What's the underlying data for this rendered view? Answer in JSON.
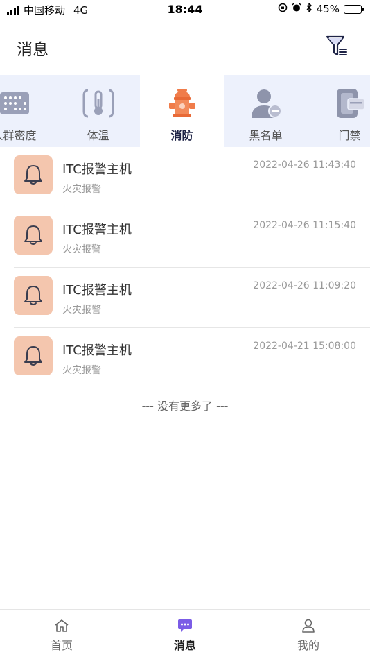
{
  "status_bar": {
    "carrier": "中国移动",
    "network": "4G",
    "time": "18:44",
    "battery_percent": "45%",
    "battery_level": 0.45
  },
  "header": {
    "title": "消息",
    "filter_icon": "filter-icon"
  },
  "tabs": [
    {
      "label": "人群密度",
      "icon": "crowd-density-icon",
      "active": false
    },
    {
      "label": "体温",
      "icon": "thermometer-icon",
      "active": false
    },
    {
      "label": "消防",
      "icon": "fire-hydrant-icon",
      "active": true
    },
    {
      "label": "黑名单",
      "icon": "blacklist-user-icon",
      "active": false
    },
    {
      "label": "门禁",
      "icon": "access-card-icon",
      "active": false
    }
  ],
  "messages": [
    {
      "title": "ITC报警主机",
      "subtitle": "火灾报警",
      "time": "2022-04-26 11:43:40"
    },
    {
      "title": "ITC报警主机",
      "subtitle": "火灾报警",
      "time": "2022-04-26 11:15:40"
    },
    {
      "title": "ITC报警主机",
      "subtitle": "火灾报警",
      "time": "2022-04-26 11:09:20"
    },
    {
      "title": "ITC报警主机",
      "subtitle": "火灾报警",
      "time": "2022-04-21 15:08:00"
    }
  ],
  "no_more_text": "--- 没有更多了 ---",
  "bottom_nav": [
    {
      "label": "首页",
      "icon": "home-icon",
      "active": false
    },
    {
      "label": "消息",
      "icon": "message-icon",
      "active": true
    },
    {
      "label": "我的",
      "icon": "user-icon",
      "active": false
    }
  ],
  "colors": {
    "accent": "#7b5ce6",
    "tab_bg": "#edf1fc",
    "bell_bg": "#f4c6ae",
    "hydrant": "#f07c4a"
  }
}
